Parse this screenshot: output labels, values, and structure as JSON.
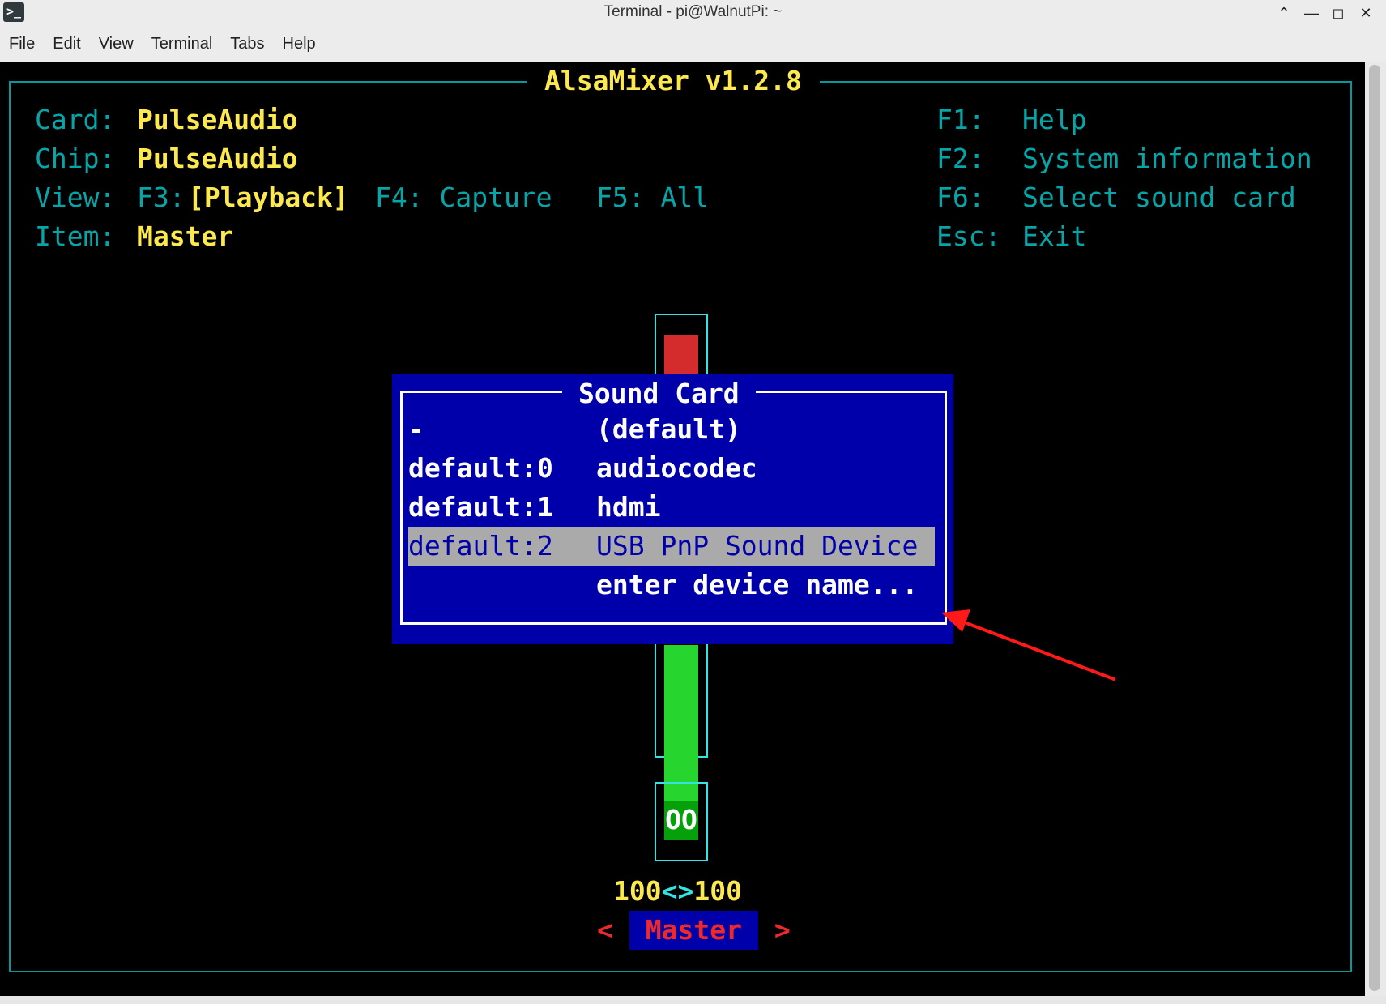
{
  "window": {
    "title": "Terminal - pi@WalnutPi: ~",
    "app_icon": "terminal-icon",
    "controls": [
      "up-chevron-icon",
      "minimize-icon",
      "maximize-icon",
      "close-icon"
    ]
  },
  "menu": [
    "File",
    "Edit",
    "View",
    "Terminal",
    "Tabs",
    "Help"
  ],
  "mixer": {
    "title": "AlsaMixer v1.2.8",
    "card_label": "Card:",
    "card_value": "PulseAudio",
    "chip_label": "Chip:",
    "chip_value": "PulseAudio",
    "view_label": "View:",
    "f3_key": "F3:",
    "f3_value": "[Playback]",
    "f4": "F4: Capture",
    "f5": "F5: All",
    "item_label": "Item:",
    "item_value": "Master",
    "shortcuts": [
      {
        "key": "F1:",
        "label": "Help"
      },
      {
        "key": "F2:",
        "label": "System information"
      },
      {
        "key": "F6:",
        "label": "Select sound card"
      },
      {
        "key": "Esc:",
        "label": "Exit"
      }
    ],
    "volume_left": "100",
    "volume_sep": "<>",
    "volume_right": "100",
    "mute_state": "OO",
    "channel_left_arrow": "<",
    "channel_name": "Master",
    "channel_right_arrow": ">"
  },
  "dialog": {
    "title": "Sound Card",
    "options": [
      {
        "device": "-",
        "name": "(default)"
      },
      {
        "device": "default:0",
        "name": "audiocodec"
      },
      {
        "device": "default:1",
        "name": "hdmi"
      },
      {
        "device": "default:2",
        "name": "USB PnP Sound Device",
        "selected": true
      },
      {
        "device": "",
        "name": "enter device name..."
      }
    ]
  },
  "colors": {
    "frame": "#06989a",
    "highlight": "#fce94f",
    "dialog_bg": "#0000aa",
    "selection_bg": "#aaaaaa",
    "annotation": "#ff1a1a"
  }
}
